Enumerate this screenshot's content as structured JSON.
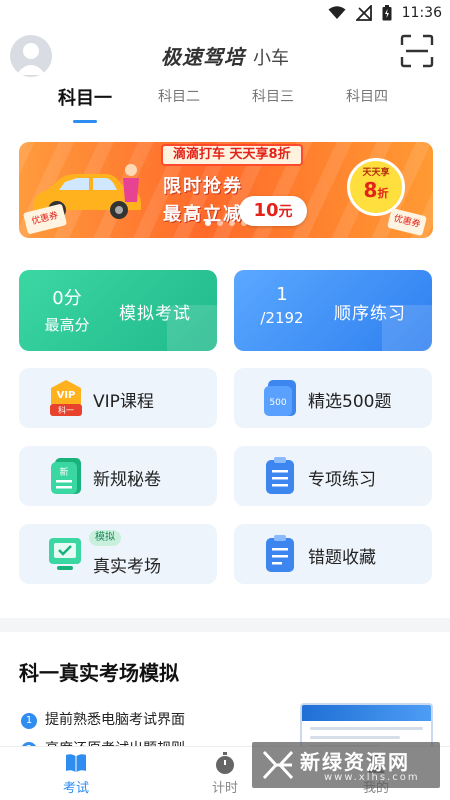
{
  "status_bar": {
    "time": "11:36"
  },
  "header": {
    "brand": "极速驾培",
    "subtitle": "小车"
  },
  "tabs": [
    {
      "label": "科目一",
      "active": true
    },
    {
      "label": "科目二",
      "active": false
    },
    {
      "label": "科目三",
      "active": false
    },
    {
      "label": "科目四",
      "active": false
    }
  ],
  "banner": {
    "top_tag": "滴滴打车 天天享8折",
    "line1": "限时抢券",
    "line2": "最高立减",
    "amount_value": "10",
    "amount_unit": "元",
    "badge_top": "天天享",
    "badge_value": "8",
    "badge_unit": "折",
    "coupon_label": "优惠券",
    "slide_count": 4,
    "active_slide": 0
  },
  "big_cards": [
    {
      "value": "0分",
      "label": "最高分",
      "name": "模拟考试",
      "color": "#21b98b"
    },
    {
      "value": "1",
      "label": "/2192",
      "name": "顺序练习",
      "color": "#2e7ff0"
    }
  ],
  "cards": [
    {
      "label": "VIP课程",
      "icon": "vip-course-icon",
      "icon_text": "科一"
    },
    {
      "label": "精选500题",
      "icon": "500-questions-icon",
      "icon_text": "500"
    },
    {
      "label": "新规秘卷",
      "icon": "new-rules-icon",
      "icon_text": "新"
    },
    {
      "label": "专项练习",
      "icon": "special-practice-icon"
    },
    {
      "label": "真实考场",
      "icon": "exam-room-icon",
      "tag": "模拟"
    },
    {
      "label": "错题收藏",
      "icon": "wrong-questions-icon"
    }
  ],
  "section": {
    "title": "科一真实考场模拟",
    "bullets": [
      {
        "num": "1",
        "text": "提前熟悉电脑考试界面"
      },
      {
        "num": "2",
        "text": "高度还原考试出题规则"
      }
    ]
  },
  "bottom_nav": [
    {
      "label": "考试",
      "icon": "book-icon",
      "active": true
    },
    {
      "label": "计时",
      "icon": "stopwatch-icon",
      "active": false
    },
    {
      "label": "我的",
      "icon": "user-icon",
      "active": false
    }
  ],
  "watermark": {
    "main": "新绿资源网",
    "sub": "www.xlhs.com"
  },
  "colors": {
    "accent": "#2f8cf0",
    "green": "#21b98b",
    "card_bg": "#eef4fc"
  }
}
